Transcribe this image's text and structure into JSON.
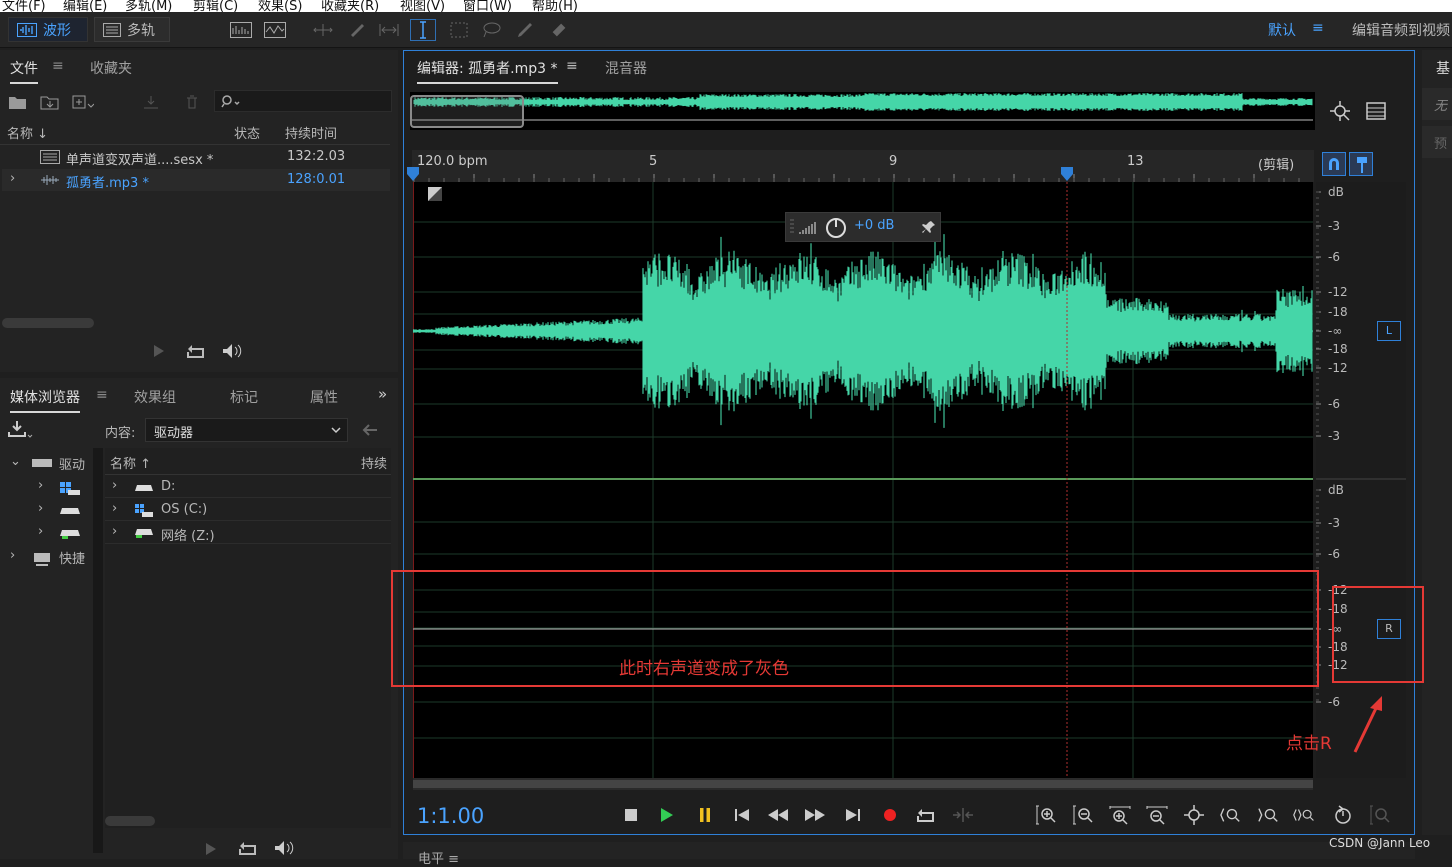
{
  "menu": [
    "文件(F)",
    "编辑(E)",
    "多轨(M)",
    "剪辑(C)",
    "效果(S)",
    "收藏夹(R)",
    "视图(V)",
    "窗口(W)",
    "帮助(H)"
  ],
  "toolbar": {
    "waveform_label": "波形",
    "multitrack_label": "多轨",
    "workspace_default": "默认",
    "workspace_menu": "≡",
    "workspace_edit": "编辑音频到视频"
  },
  "files_panel": {
    "tab_files": "文件",
    "tab_favorites": "收藏夹",
    "columns": [
      "名称",
      "状态",
      "持续时间"
    ],
    "rows": [
      {
        "name": "单声道变双声道....sesx *",
        "duration": "132:2.03"
      },
      {
        "name": "孤勇者.mp3 *",
        "duration": "128:0.01"
      }
    ]
  },
  "media_panel": {
    "tabs": [
      "媒体浏览器",
      "效果组",
      "标记",
      "属性"
    ],
    "content_label": "内容:",
    "content_value": "驱动器",
    "tree_root": "驱动",
    "tree_shortcut": "快捷",
    "columns": [
      "名称",
      "持续"
    ],
    "drives": [
      "D:",
      "OS (C:)",
      "网络 (Z:)"
    ]
  },
  "editor": {
    "tab_editor": "编辑器: 孤勇者.mp3 *",
    "tab_mixer": "混音器",
    "ruler": {
      "bpm": "120.0 bpm",
      "ticks": [
        "5",
        "9",
        "13"
      ],
      "clip": "(剪辑)"
    },
    "hud_gain": "+0 dB",
    "channel_left": "L",
    "channel_right": "R",
    "db_left": [
      "dB",
      "-3",
      "-6",
      "-12",
      "-18",
      "-∞",
      "-18",
      "-12",
      "-6",
      "-3"
    ],
    "db_right": [
      "dB",
      "-3",
      "-6",
      "-12",
      "-18",
      "-∞",
      "-18",
      "-12",
      "-6"
    ],
    "timecode": "1:1.00",
    "annotation_text": "此时右声道变成了灰色",
    "annotation_click": "点击R",
    "bottom_panel": "电平"
  },
  "right_panel": {
    "tab": "基",
    "items": [
      "无",
      "预"
    ]
  },
  "watermark": "CSDN @Jann Leo",
  "colors": {
    "accent": "#4aa3ff",
    "waveform": "#45d6a8",
    "annotation": "#e53935"
  }
}
